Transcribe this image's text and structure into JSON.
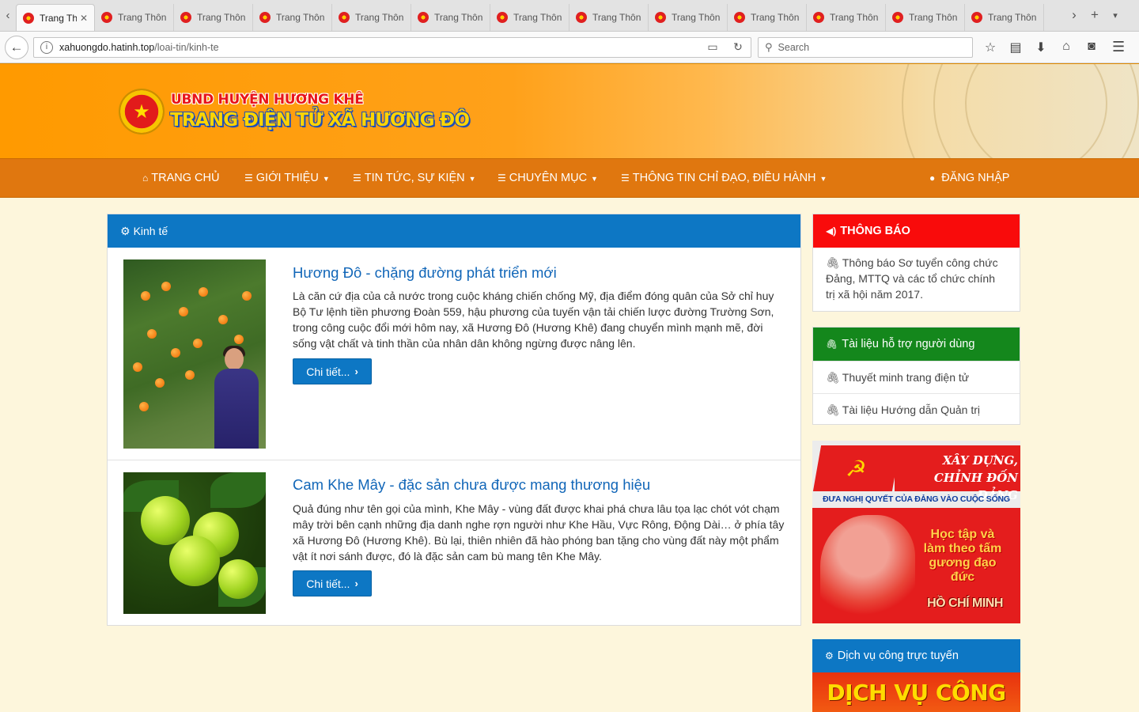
{
  "browser": {
    "tabs": [
      {
        "label": "Trang Th",
        "active": true
      },
      {
        "label": "Trang Thôn"
      },
      {
        "label": "Trang Thôn"
      },
      {
        "label": "Trang Thôn"
      },
      {
        "label": "Trang Thôn"
      },
      {
        "label": "Trang Thôn"
      },
      {
        "label": "Trang Thôn"
      },
      {
        "label": "Trang Thôn"
      },
      {
        "label": "Trang Thôn"
      },
      {
        "label": "Trang Thôn"
      },
      {
        "label": "Trang Thôn"
      },
      {
        "label": "Trang Thôn"
      },
      {
        "label": "Trang Thôn"
      }
    ],
    "url_host": "xahuongdo.hatinh.top",
    "url_path": "/loai-tin/kinh-te",
    "search_placeholder": "Search"
  },
  "header": {
    "line1": "UBND HUYỆN HƯƠNG KHÊ",
    "line2": "TRANG ĐIỆN TỬ XÃ HƯƠNG ĐÔ"
  },
  "menu": {
    "home": "TRANG CHỦ",
    "about": "GIỚI THIỆU",
    "news": "TIN TỨC, SỰ KIỆN",
    "sections": "CHUYÊN MỤC",
    "directives": "THÔNG TIN CHỈ ĐẠO, ĐIỀU HÀNH",
    "login": "ĐĂNG NHẬP"
  },
  "main": {
    "heading": "Kinh tế",
    "articles": [
      {
        "title": "Hương Đô - chặng đường phát triển mới",
        "summary": "Là căn cứ địa của cả nước trong cuộc kháng chiến chống Mỹ, địa điểm đóng quân của Sở chỉ huy Bộ Tư lệnh tiền phương Đoàn 559, hậu phương của tuyến vận tải chiến lược đường Trường Sơn, trong công cuộc đổi mới hôm nay, xã Hương Đô (Hương Khê) đang chuyển mình mạnh mẽ, đời sống vật chất và tinh thần của nhân dân không ngừng được nâng lên.",
        "button": "Chi tiết..."
      },
      {
        "title": "Cam Khe Mây - đặc sản chưa được mang thương hiệu",
        "summary": "Quả đúng như tên gọi của mình, Khe Mây - vùng đất được khai phá chưa lâu tọa lạc chót vót chạm mây trời bên cạnh những địa danh nghe rợn người như Khe Hầu, Vực Rông, Động Dài… ở phía tây xã Hương Đô (Hương Khê). Bù lại, thiên nhiên đã hào phóng ban tặng cho vùng đất này một phẩm vật ít nơi sánh được, đó là đặc sản cam bù mang tên Khe Mây.",
        "button": "Chi tiết..."
      }
    ]
  },
  "sidebar": {
    "notice": {
      "heading": "THÔNG BÁO",
      "text": "Thông báo Sơ tuyển công chức Đảng, MTTQ và các tổ chức chính trị xã hội năm 2017."
    },
    "docs": {
      "heading": "Tài liệu hỗ trợ người dùng",
      "items": [
        "Thuyết minh trang điện tử",
        "Tài liệu Hướng dẫn Quản trị"
      ]
    },
    "banner_party": {
      "title": "XÂY DỰNG, CHỈNH ĐỐN ĐẢNG",
      "subtitle": "ĐƯA NGHỊ QUYẾT CỦA ĐẢNG VÀO CUỘC SỐNG",
      "slogan": "Học tập và làm theo tấm gương đạo đức",
      "name": "HỒ CHÍ MINH"
    },
    "online_services": {
      "heading": "Dịch vụ công trực tuyến",
      "banner": "DỊCH VỤ CÔNG"
    }
  },
  "colors": {
    "menu_bg": "#e0770f",
    "header_orange": "#ff9a00",
    "primary_blue": "#0d77c4",
    "notice_red": "#f90b0b",
    "docs_green": "#14871c",
    "link_blue": "#1166b8"
  },
  "icons": {
    "menu_home": "home-icon",
    "menu_list": "list-icon",
    "menu_user": "user-icon",
    "heading_gear": "gear-icon",
    "notice": "bullhorn-icon",
    "clip": "paperclip-icon"
  }
}
